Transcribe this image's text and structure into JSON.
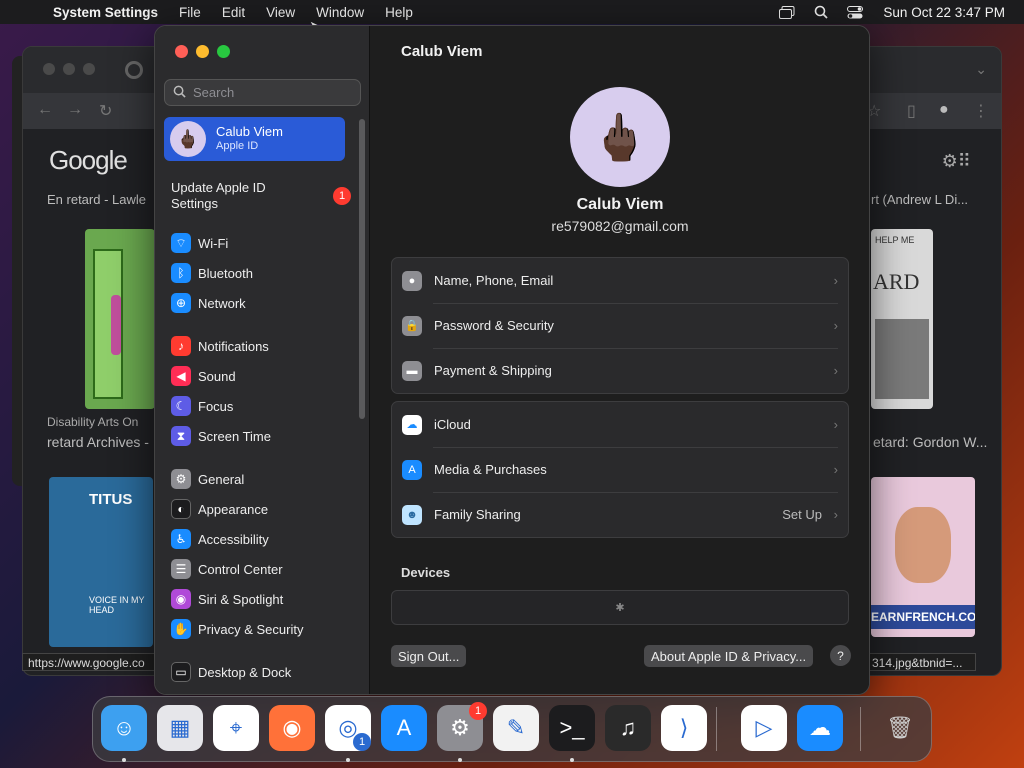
{
  "menubar": {
    "app_name": "System Settings",
    "menus": [
      "File",
      "Edit",
      "View",
      "Window",
      "Help"
    ],
    "clock": "Sun Oct 22  3:47 PM"
  },
  "chrome": {
    "logo": "Google",
    "caption_left": "En retard - Lawle",
    "caption_right": "rt (Andrew L Di...",
    "source_left": "Disability Arts On",
    "result_left": "retard Archives -",
    "result_right": "etard: Gordon W...",
    "status_url_left": "https://www.google.co",
    "status_url_right": "314.jpg&tbnid=...",
    "thumb_book_title": "TITUS",
    "thumb_book_sub": "VOICE IN MY HEAD",
    "thumb_right_text": "ARD",
    "thumb_right_top": "HELP ME",
    "thumb_right_banner": "EARNFRENCH.COM"
  },
  "sidebar": {
    "search_placeholder": "Search",
    "account": {
      "name": "Calub Viem",
      "sub": "Apple ID"
    },
    "update": {
      "label": "Update Apple ID Settings",
      "badge": "1"
    },
    "items": [
      {
        "label": "Wi-Fi",
        "icon": "wifi-icon",
        "color": "#1a8cff"
      },
      {
        "label": "Bluetooth",
        "icon": "bluetooth-icon",
        "color": "#1a8cff"
      },
      {
        "label": "Network",
        "icon": "globe-icon",
        "color": "#1a8cff"
      },
      {
        "label": "Notifications",
        "icon": "bell-icon",
        "color": "#ff3b30"
      },
      {
        "label": "Sound",
        "icon": "speaker-icon",
        "color": "#ff2d55"
      },
      {
        "label": "Focus",
        "icon": "moon-icon",
        "color": "#5e5ce6"
      },
      {
        "label": "Screen Time",
        "icon": "hourglass-icon",
        "color": "#5e5ce6"
      },
      {
        "label": "General",
        "icon": "gear-icon",
        "color": "#8e8e93"
      },
      {
        "label": "Appearance",
        "icon": "appearance-icon",
        "color": "#1c1c1e"
      },
      {
        "label": "Accessibility",
        "icon": "accessibility-icon",
        "color": "#1a8cff"
      },
      {
        "label": "Control Center",
        "icon": "control-center-icon",
        "color": "#8e8e93"
      },
      {
        "label": "Siri & Spotlight",
        "icon": "siri-icon",
        "color": "#b04ad8"
      },
      {
        "label": "Privacy & Security",
        "icon": "hand-icon",
        "color": "#1a8cff"
      },
      {
        "label": "Desktop & Dock",
        "icon": "dock-icon",
        "color": "#1c1c1e"
      }
    ]
  },
  "main": {
    "title": "Calub Viem",
    "name": "Calub Viem",
    "email": "re579082@gmail.com",
    "group1": [
      {
        "label": "Name, Phone, Email",
        "icon": "person-icon",
        "color": "#8e8e93"
      },
      {
        "label": "Password & Security",
        "icon": "lock-icon",
        "color": "#8e8e93"
      },
      {
        "label": "Payment & Shipping",
        "icon": "card-icon",
        "color": "#8e8e93"
      }
    ],
    "group2": [
      {
        "label": "iCloud",
        "icon": "cloud-icon",
        "color": "#ffffff",
        "aux": ""
      },
      {
        "label": "Media & Purchases",
        "icon": "app-store-icon",
        "color": "#1a8cff",
        "aux": ""
      },
      {
        "label": "Family Sharing",
        "icon": "family-icon",
        "color": "#bfe4ff",
        "aux": "Set Up"
      }
    ],
    "devices_label": "Devices",
    "sign_out": "Sign Out...",
    "about": "About Apple ID & Privacy...",
    "help": "?"
  },
  "dock": {
    "apps": [
      {
        "name": "finder-icon",
        "bg": "#3da0f0",
        "glyph": "☺",
        "running": true
      },
      {
        "name": "launchpad-icon",
        "bg": "#e6e6ea",
        "glyph": "▦",
        "running": false
      },
      {
        "name": "safari-icon",
        "bg": "#ffffff",
        "glyph": "⌖",
        "running": false
      },
      {
        "name": "firefox-icon",
        "bg": "#ff7139",
        "glyph": "◉",
        "running": false
      },
      {
        "name": "chrome-icon",
        "bg": "#ffffff",
        "glyph": "◎",
        "running": true
      },
      {
        "name": "app-store-icon",
        "bg": "#1a8cff",
        "glyph": "A",
        "running": false
      },
      {
        "name": "system-settings-icon",
        "bg": "#8e8e93",
        "glyph": "⚙",
        "running": true
      },
      {
        "name": "textedit-icon",
        "bg": "#f2f2f2",
        "glyph": "✎",
        "running": false
      },
      {
        "name": "terminal-icon",
        "bg": "#1c1c1e",
        "glyph": ">_",
        "running": true
      },
      {
        "name": "garageband-icon",
        "bg": "#2a2a2a",
        "glyph": "♫",
        "running": false
      },
      {
        "name": "vscode-icon",
        "bg": "#ffffff",
        "glyph": "⟩",
        "running": false
      },
      {
        "name": "visual-studio-icon",
        "bg": "#ffffff",
        "glyph": "▷",
        "running": false
      },
      {
        "name": "weather-icon",
        "bg": "#1a8cff",
        "glyph": "☁",
        "running": false
      },
      {
        "name": "trash-icon",
        "bg": "transparent",
        "glyph": "🗑",
        "running": false
      }
    ],
    "settings_badge": "1",
    "chrome_badge": "1"
  }
}
